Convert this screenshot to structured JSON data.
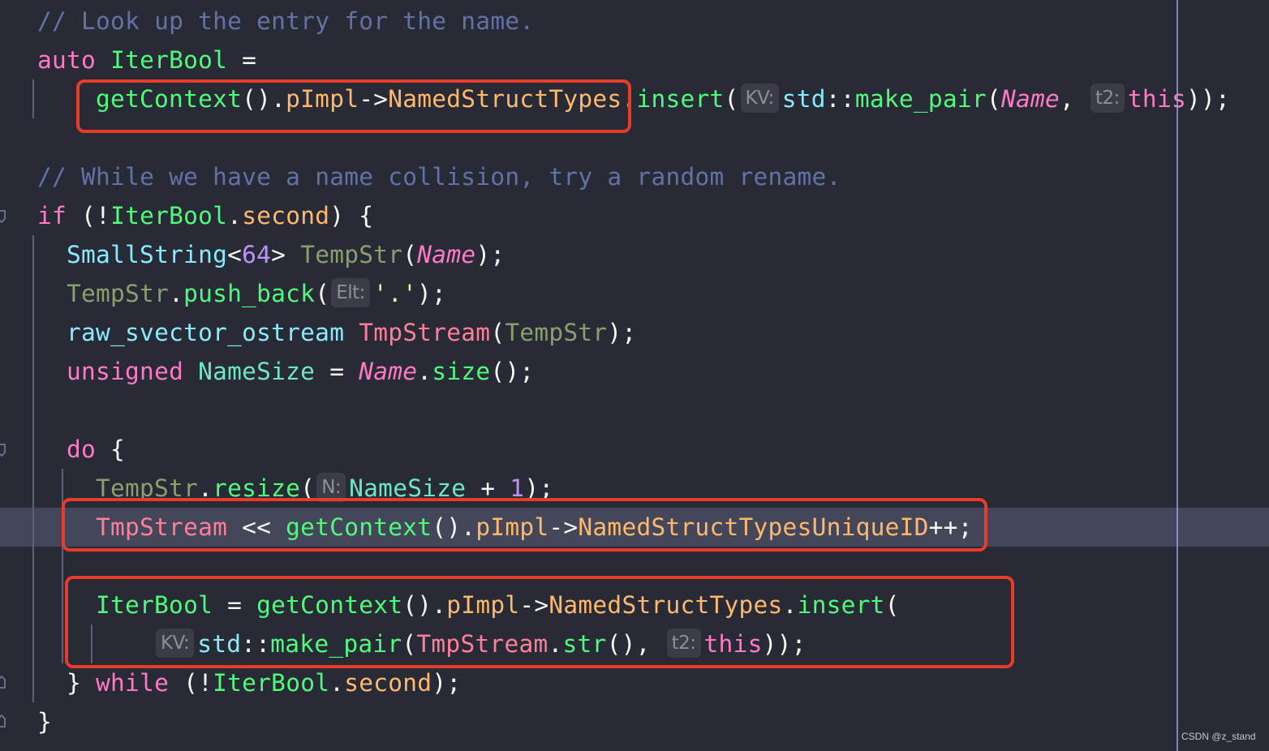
{
  "editor": {
    "lines": [
      {
        "indent": 0,
        "tokens": [
          {
            "k": "comment",
            "t": "// Look up the entry for the name."
          }
        ]
      },
      {
        "indent": 0,
        "tokens": [
          {
            "k": "kw",
            "t": "auto"
          },
          {
            "k": "plain",
            "t": " "
          },
          {
            "k": "var",
            "t": "IterBool"
          },
          {
            "k": "plain",
            "t": " ="
          }
        ]
      },
      {
        "indent": 2,
        "tokens": [
          {
            "k": "fn",
            "t": "getContext"
          },
          {
            "k": "plain",
            "t": "()."
          },
          {
            "k": "field",
            "t": "pImpl"
          },
          {
            "k": "plain",
            "t": "->"
          },
          {
            "k": "field",
            "t": "NamedStructTypes"
          },
          {
            "k": "plain",
            "t": "."
          },
          {
            "k": "fn",
            "t": "insert"
          },
          {
            "k": "plain",
            "t": "("
          },
          {
            "k": "hint",
            "t": "KV:"
          },
          {
            "k": "type",
            "t": "std"
          },
          {
            "k": "plain",
            "t": "::"
          },
          {
            "k": "fn",
            "t": "make_pair"
          },
          {
            "k": "plain",
            "t": "("
          },
          {
            "k": "param",
            "t": "Name"
          },
          {
            "k": "plain",
            "t": ", "
          },
          {
            "k": "hint",
            "t": "t2:"
          },
          {
            "k": "kw",
            "t": "this"
          },
          {
            "k": "plain",
            "t": "));"
          }
        ]
      },
      {
        "indent": 0,
        "tokens": []
      },
      {
        "indent": 0,
        "tokens": [
          {
            "k": "comment",
            "t": "// While we have a name collision, try a random rename."
          }
        ]
      },
      {
        "indent": 0,
        "tokens": [
          {
            "k": "kw",
            "t": "if"
          },
          {
            "k": "plain",
            "t": " (!"
          },
          {
            "k": "var",
            "t": "IterBool"
          },
          {
            "k": "plain",
            "t": "."
          },
          {
            "k": "field",
            "t": "second"
          },
          {
            "k": "plain",
            "t": ") {"
          }
        ]
      },
      {
        "indent": 1,
        "tokens": [
          {
            "k": "type",
            "t": "SmallString"
          },
          {
            "k": "plain",
            "t": "<"
          },
          {
            "k": "num",
            "t": "64"
          },
          {
            "k": "plain",
            "t": "> "
          },
          {
            "k": "local",
            "t": "TempStr"
          },
          {
            "k": "plain",
            "t": "("
          },
          {
            "k": "param",
            "t": "Name"
          },
          {
            "k": "plain",
            "t": ");"
          }
        ]
      },
      {
        "indent": 1,
        "tokens": [
          {
            "k": "local",
            "t": "TempStr"
          },
          {
            "k": "plain",
            "t": "."
          },
          {
            "k": "fn",
            "t": "push_back"
          },
          {
            "k": "plain",
            "t": "("
          },
          {
            "k": "hint",
            "t": "Elt:"
          },
          {
            "k": "str",
            "t": "'.'"
          },
          {
            "k": "plain",
            "t": ");"
          }
        ]
      },
      {
        "indent": 1,
        "tokens": [
          {
            "k": "type",
            "t": "raw_svector_ostream"
          },
          {
            "k": "plain",
            "t": " "
          },
          {
            "k": "stream",
            "t": "TmpStream"
          },
          {
            "k": "plain",
            "t": "("
          },
          {
            "k": "local",
            "t": "TempStr"
          },
          {
            "k": "plain",
            "t": ");"
          }
        ]
      },
      {
        "indent": 1,
        "tokens": [
          {
            "k": "kw",
            "t": "unsigned"
          },
          {
            "k": "plain",
            "t": " "
          },
          {
            "k": "local2",
            "t": "NameSize"
          },
          {
            "k": "plain",
            "t": " = "
          },
          {
            "k": "param",
            "t": "Name"
          },
          {
            "k": "plain",
            "t": "."
          },
          {
            "k": "fn",
            "t": "size"
          },
          {
            "k": "plain",
            "t": "();"
          }
        ]
      },
      {
        "indent": 0,
        "tokens": []
      },
      {
        "indent": 1,
        "tokens": [
          {
            "k": "kw",
            "t": "do"
          },
          {
            "k": "plain",
            "t": " {"
          }
        ]
      },
      {
        "indent": 2,
        "tokens": [
          {
            "k": "local",
            "t": "TempStr"
          },
          {
            "k": "plain",
            "t": "."
          },
          {
            "k": "fn",
            "t": "resize"
          },
          {
            "k": "plain",
            "t": "("
          },
          {
            "k": "hint",
            "t": "N:"
          },
          {
            "k": "local2",
            "t": "NameSize"
          },
          {
            "k": "plain",
            "t": " + "
          },
          {
            "k": "num",
            "t": "1"
          },
          {
            "k": "plain",
            "t": ");"
          }
        ]
      },
      {
        "indent": 2,
        "tokens": [
          {
            "k": "stream",
            "t": "TmpStream"
          },
          {
            "k": "plain",
            "t": " << "
          },
          {
            "k": "fn",
            "t": "getContext"
          },
          {
            "k": "plain",
            "t": "()."
          },
          {
            "k": "field",
            "t": "pImpl"
          },
          {
            "k": "plain",
            "t": "->"
          },
          {
            "k": "field",
            "t": "NamedStructTypesUniqueID"
          },
          {
            "k": "plain",
            "t": "++;"
          }
        ]
      },
      {
        "indent": 0,
        "tokens": []
      },
      {
        "indent": 2,
        "tokens": [
          {
            "k": "var",
            "t": "IterBool"
          },
          {
            "k": "plain",
            "t": " = "
          },
          {
            "k": "fn",
            "t": "getContext"
          },
          {
            "k": "plain",
            "t": "()."
          },
          {
            "k": "field",
            "t": "pImpl"
          },
          {
            "k": "plain",
            "t": "->"
          },
          {
            "k": "field",
            "t": "NamedStructTypes"
          },
          {
            "k": "plain",
            "t": "."
          },
          {
            "k": "fn",
            "t": "insert"
          },
          {
            "k": "plain",
            "t": "("
          }
        ]
      },
      {
        "indent": 4,
        "tokens": [
          {
            "k": "hint",
            "t": "KV:"
          },
          {
            "k": "type",
            "t": "std"
          },
          {
            "k": "plain",
            "t": "::"
          },
          {
            "k": "fn",
            "t": "make_pair"
          },
          {
            "k": "plain",
            "t": "("
          },
          {
            "k": "stream",
            "t": "TmpStream"
          },
          {
            "k": "plain",
            "t": "."
          },
          {
            "k": "fn",
            "t": "str"
          },
          {
            "k": "plain",
            "t": "(), "
          },
          {
            "k": "hint",
            "t": "t2:"
          },
          {
            "k": "kw",
            "t": "this"
          },
          {
            "k": "plain",
            "t": "));"
          }
        ]
      },
      {
        "indent": 1,
        "tokens": [
          {
            "k": "plain",
            "t": "} "
          },
          {
            "k": "kw",
            "t": "while"
          },
          {
            "k": "plain",
            "t": " (!"
          },
          {
            "k": "var",
            "t": "IterBool"
          },
          {
            "k": "plain",
            "t": "."
          },
          {
            "k": "field",
            "t": "second"
          },
          {
            "k": "plain",
            "t": ");"
          }
        ]
      },
      {
        "indent": 0,
        "tokens": [
          {
            "k": "plain",
            "t": "}"
          }
        ]
      }
    ]
  },
  "colors": {
    "background": "#282a36",
    "current_line": "#44475a",
    "highlight_box": "#e63c28",
    "comment": "#6272a4",
    "keyword": "#ff79c6",
    "function": "#50fa7b",
    "field": "#ffb86c",
    "type": "#8be9fd"
  },
  "watermark": "CSDN @z_stand"
}
